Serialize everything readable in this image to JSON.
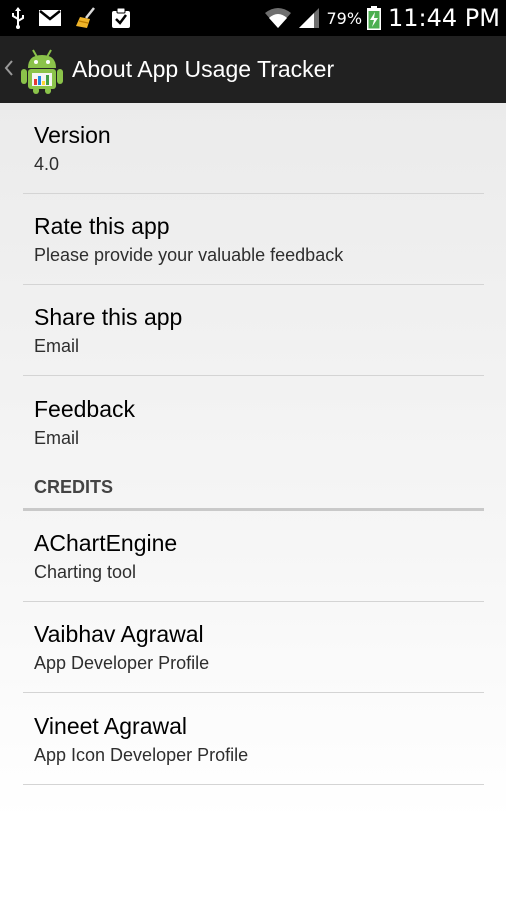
{
  "status_bar": {
    "icons_left": [
      "usb-icon",
      "gmail-icon",
      "cleaner-broom-icon",
      "clipboard-check-icon"
    ],
    "battery_percent": "79%",
    "time": "11:44 PM"
  },
  "action_bar": {
    "title": "About App Usage Tracker"
  },
  "items": [
    {
      "title": "Version",
      "summary": "4.0"
    },
    {
      "title": "Rate this app",
      "summary": "Please provide your valuable feedback"
    },
    {
      "title": "Share this app",
      "summary": "Email"
    },
    {
      "title": "Feedback",
      "summary": "Email"
    }
  ],
  "credits": {
    "header": "CREDITS",
    "items": [
      {
        "title": "AChartEngine",
        "summary": "Charting tool"
      },
      {
        "title": "Vaibhav Agrawal",
        "summary": "App Developer Profile"
      },
      {
        "title": "Vineet Agrawal",
        "summary": "App Icon Developer Profile"
      }
    ]
  },
  "colors": {
    "status_bar_bg": "#000000",
    "action_bar_bg": "#212121",
    "android_green": "#8bc34a",
    "battery_green": "#4caf50"
  }
}
